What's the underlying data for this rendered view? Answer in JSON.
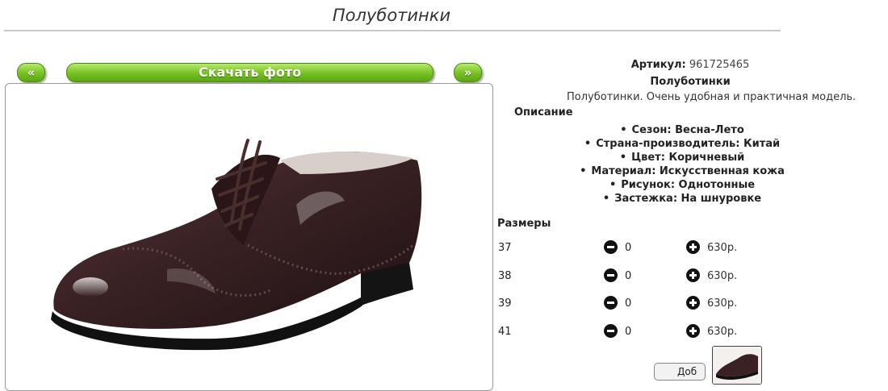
{
  "page": {
    "title": "Полуботинки"
  },
  "gallery": {
    "prev_label": "«",
    "download_label": "Скачать фото",
    "next_label": "»"
  },
  "product": {
    "article_label": "Артикул:",
    "article_value": "961725465",
    "name": "Полуботинки",
    "short_description": "Полуботинки. Очень удобная и практичная модель.",
    "description_heading": "Описание",
    "specs": [
      "Сезон: Весна-Лето",
      "Страна-производитель: Китай",
      "Цвет: Коричневый",
      "Материал: Искусственная кожа",
      "Рисунок: Однотонные",
      "Застежка: На шнуровке"
    ]
  },
  "sizes": {
    "heading": "Размеры",
    "rows": [
      {
        "size": "37",
        "qty": "0",
        "price": "630р."
      },
      {
        "size": "38",
        "qty": "0",
        "price": "630р."
      },
      {
        "size": "39",
        "qty": "0",
        "price": "630р."
      },
      {
        "size": "41",
        "qty": "0",
        "price": "630р."
      }
    ]
  },
  "cart": {
    "button_label": "Доб"
  },
  "colors": {
    "button_green": "#76c024",
    "shoe_brown": "#3a2224",
    "sole_black": "#111111"
  }
}
